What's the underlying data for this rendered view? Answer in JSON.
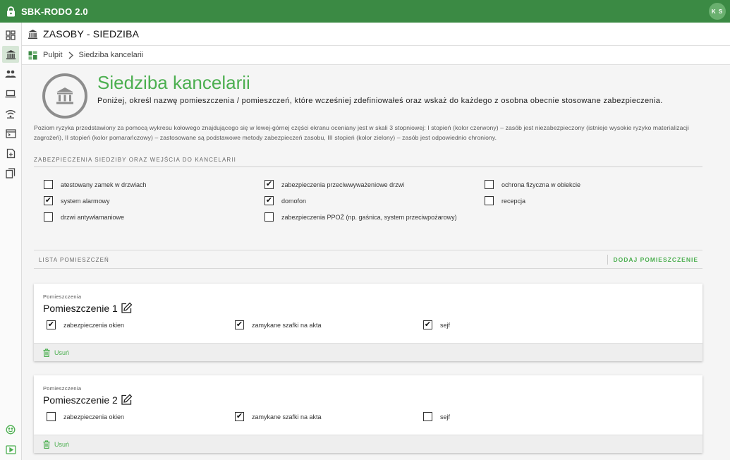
{
  "app": {
    "title": "SBK-RODO 2.0",
    "user_initials": "K S"
  },
  "header": {
    "title": "ZASOBY - SIEDZIBA"
  },
  "breadcrumb": {
    "home": "Pulpit",
    "current": "Siedziba kancelarii"
  },
  "page": {
    "title": "Siedziba kancelarii",
    "description": "Poniżej, określ nazwę pomieszczenia / pomieszczeń, które wcześniej zdefiniowałeś oraz wskaż do każdego z osobna obecnie stosowane zabezpieczenia.",
    "risk_note": "Poziom ryzyka przedstawiony za pomocą wykresu kołowego znajdującego się w lewej-górnej części ekranu oceniany jest w skali 3 stopniowej: I stopień (kolor czerwony) – zasób jest niezabezpieczony (istnieje wysokie ryzyko materializacji zagrożeń), II stopień (kolor pomarańczowy) – zastosowane są podstawowe metody zabezpieczeń zasobu, III stopień (kolor zielony) – zasób jest odpowiednio chroniony."
  },
  "security_section": {
    "label": "ZABEZPIECZENIA SIEDZIBY ORAZ WEJŚCIA DO KANCELARII",
    "options": [
      {
        "label": "atestowany zamek w drzwiach",
        "checked": false
      },
      {
        "label": "system alarmowy",
        "checked": true
      },
      {
        "label": "drzwi antywłamaniowe",
        "checked": false
      },
      {
        "label": "zabezpieczenia przeciwwyważeniowe drzwi",
        "checked": true
      },
      {
        "label": "domofon",
        "checked": true
      },
      {
        "label": "zabezpieczenia PPOŻ (np. gaśnica, system przeciwpożarowy)",
        "checked": false
      },
      {
        "label": "ochrona fizyczna w obiekcie",
        "checked": false
      },
      {
        "label": "recepcja",
        "checked": false
      }
    ]
  },
  "rooms_section": {
    "label": "LISTA POMIESZCZEŃ",
    "add_label": "DODAJ POMIESZCZENIE"
  },
  "rooms": [
    {
      "caption": "Pomieszczenia",
      "name": "Pomieszczenie 1",
      "delete_label": "Usuń",
      "options": [
        {
          "label": "zabezpieczenia okien",
          "checked": true
        },
        {
          "label": "zamykane szafki na akta",
          "checked": true
        },
        {
          "label": "sejf",
          "checked": true
        }
      ]
    },
    {
      "caption": "Pomieszczenia",
      "name": "Pomieszczenie 2",
      "delete_label": "Usuń",
      "options": [
        {
          "label": "zabezpieczenia okien",
          "checked": false
        },
        {
          "label": "zamykane szafki na akta",
          "checked": true
        },
        {
          "label": "sejf",
          "checked": false
        }
      ]
    }
  ],
  "colors": {
    "brand": "#3b8a44",
    "accent": "#4caf50",
    "icon_gray": "#8d8d8d"
  },
  "icons": {
    "sidebar": [
      "dashboard-icon",
      "bank-icon",
      "people-icon",
      "laptop-icon",
      "wifi-icon",
      "terminal-icon",
      "document-add-icon",
      "copy-icon",
      "smiley-icon",
      "play-icon"
    ]
  }
}
